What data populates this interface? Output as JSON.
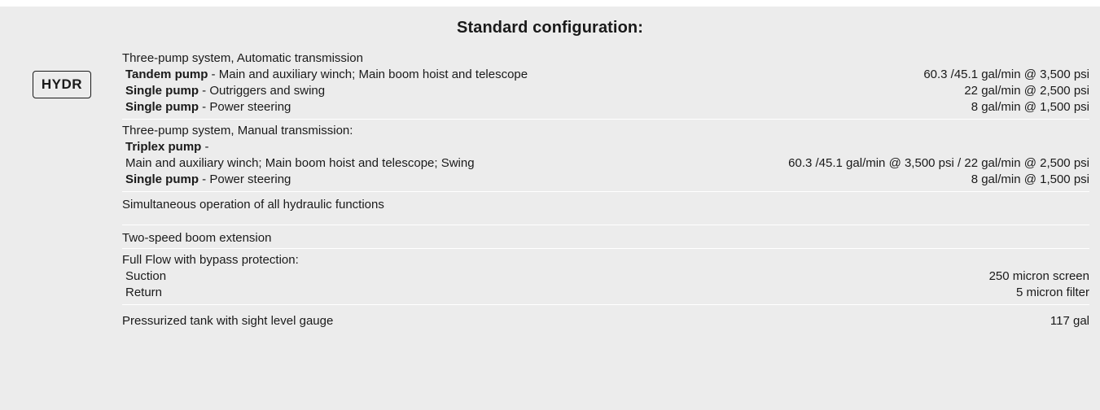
{
  "heading": "Standard configuration:",
  "badge": "HYDR",
  "auto_system": {
    "title": "Three-pump system, Automatic transmission",
    "rows": [
      {
        "pump": "Tandem pump",
        "sep": " - ",
        "desc": "Main and auxiliary winch; Main boom hoist and telescope",
        "value": "60.3 /45.1 gal/min @ 3,500 psi"
      },
      {
        "pump": "Single pump",
        "sep": " - ",
        "desc": "Outriggers and swing",
        "value": "22 gal/min @ 2,500 psi"
      },
      {
        "pump": "Single pump",
        "sep": " - ",
        "desc": "Power steering",
        "value": "8 gal/min @ 1,500 psi"
      }
    ]
  },
  "manual_system": {
    "title": "Three-pump system, Manual transmission:",
    "triplex_pump": "Triplex pump",
    "triplex_sep": " -",
    "triplex_desc": "Main and auxiliary winch; Main boom hoist and telescope; Swing",
    "triplex_value": "60.3 /45.1 gal/min @ 3,500 psi / 22 gal/min @ 2,500 psi",
    "steering_pump": "Single pump",
    "steering_sep": " - ",
    "steering_desc": "Power steering",
    "steering_value": "8 gal/min @ 1,500 psi"
  },
  "simultaneous": "Simultaneous operation of all hydraulic functions",
  "two_speed": "Two-speed boom extension",
  "filtration": {
    "title": "Full Flow with bypass protection:",
    "rows": [
      {
        "label": "Suction",
        "value": "250 micron screen"
      },
      {
        "label": "Return",
        "value": "5 micron filter"
      }
    ]
  },
  "tank": {
    "label": "Pressurized tank with sight level gauge",
    "value": "117 gal"
  }
}
